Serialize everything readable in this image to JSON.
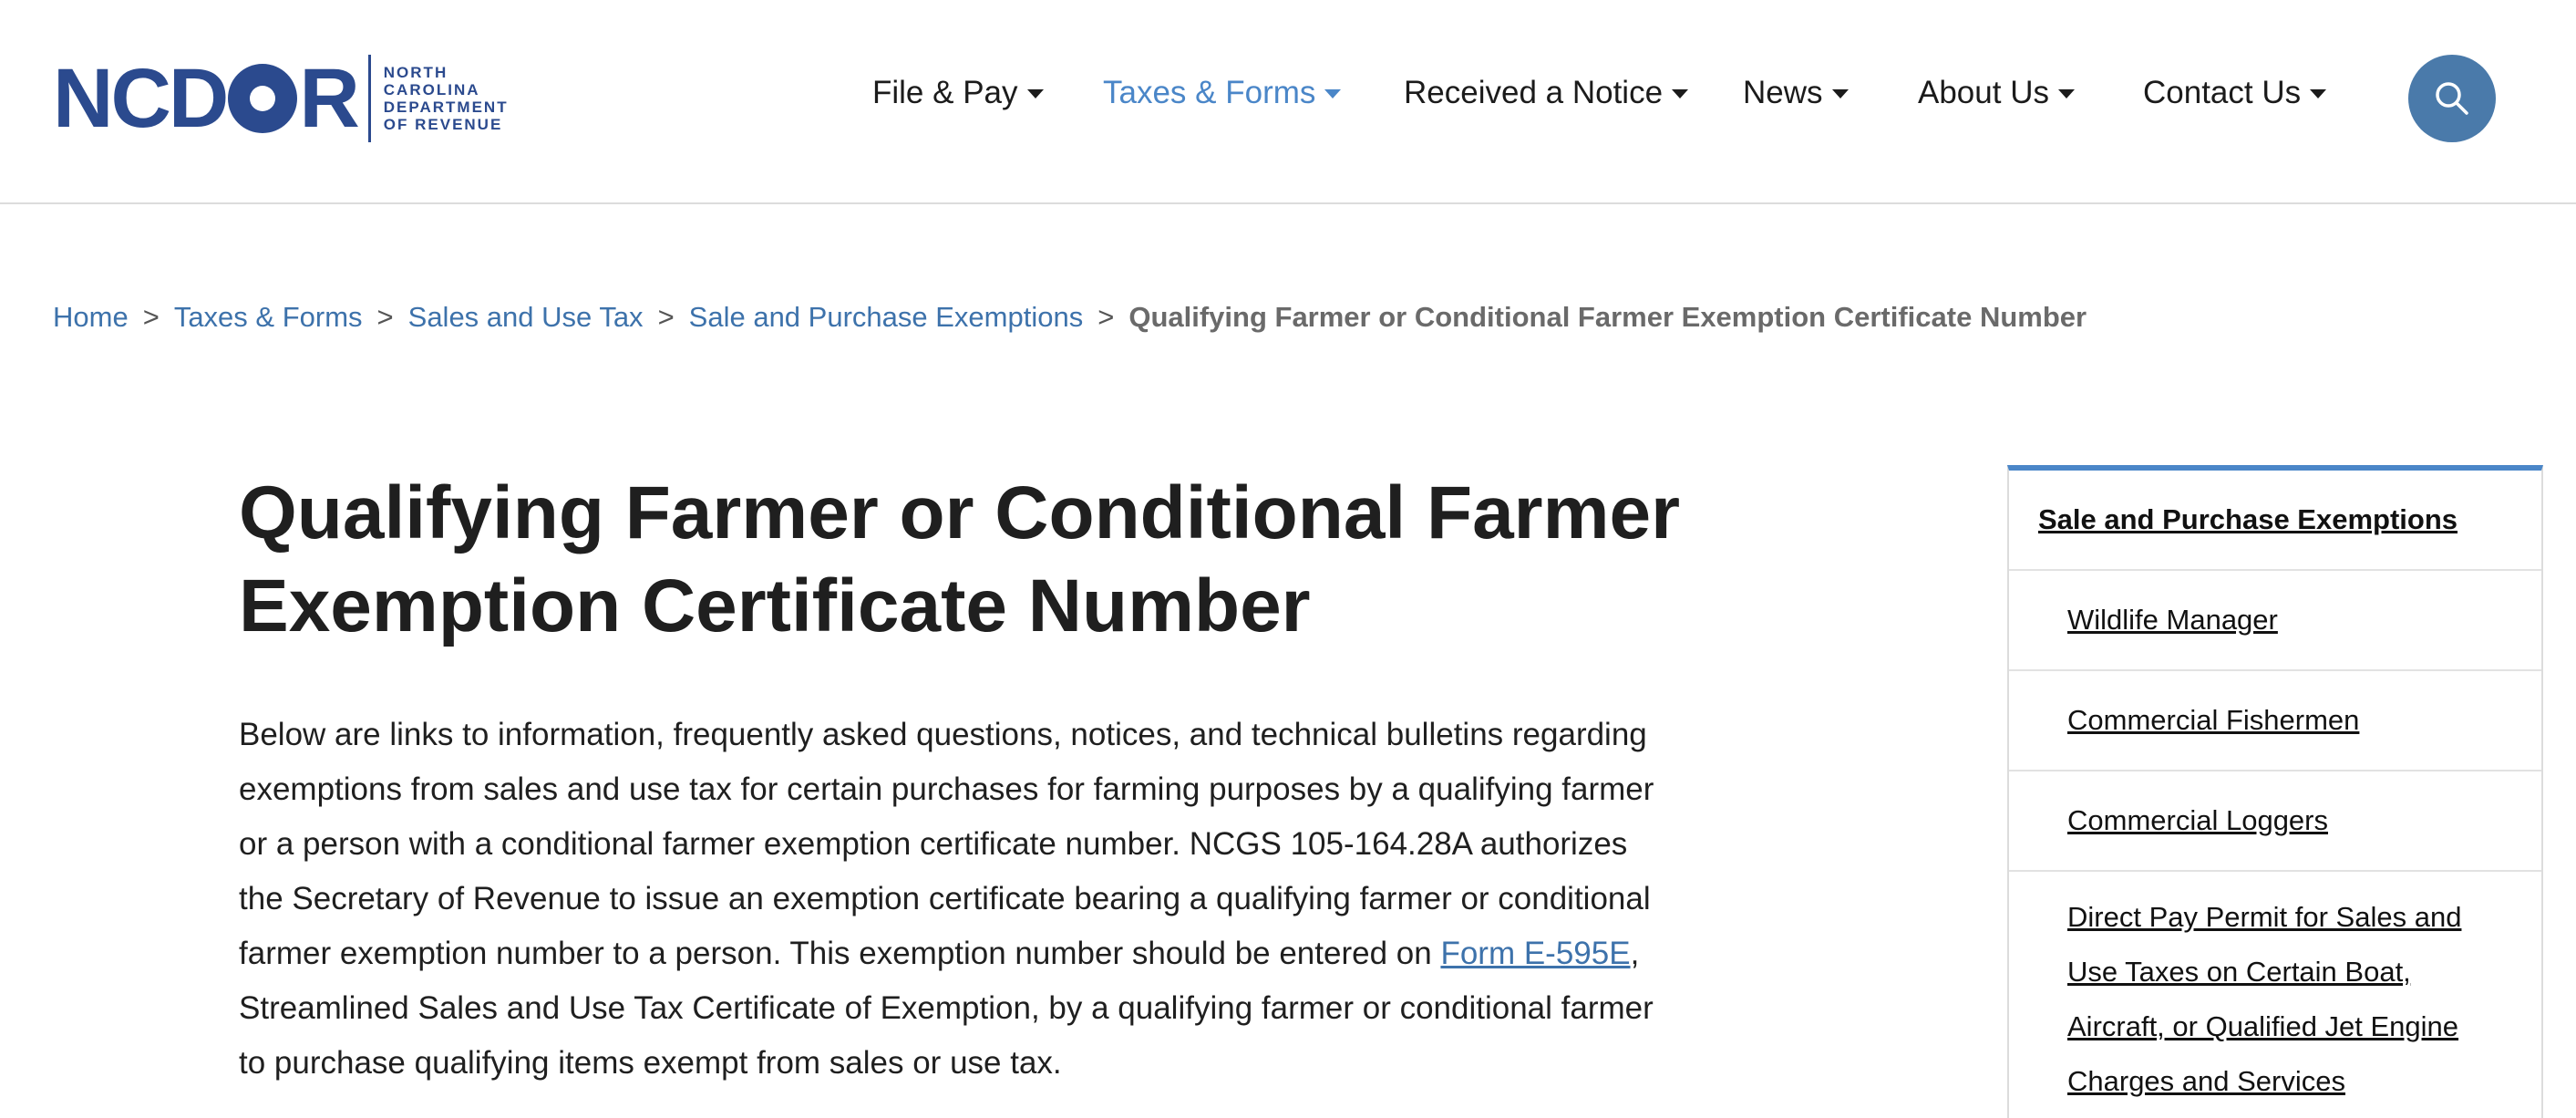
{
  "logo": {
    "word_left": "NCD",
    "word_right": "R",
    "subtitle_lines": [
      "NORTH",
      "CAROLINA",
      "DEPARTMENT",
      "OF REVENUE"
    ]
  },
  "nav": {
    "items": [
      {
        "label": "File & Pay"
      },
      {
        "label": "Taxes & Forms"
      },
      {
        "label": "Received a Notice"
      },
      {
        "label": "News"
      },
      {
        "label": "About Us"
      },
      {
        "label": "Contact Us"
      }
    ],
    "active": "Taxes & Forms",
    "search_icon": "search-icon"
  },
  "breadcrumb": {
    "links": [
      "Home",
      "Taxes & Forms",
      "Sales and Use Tax",
      "Sale and Purchase Exemptions"
    ],
    "separator": ">",
    "current": "Qualifying Farmer or Conditional Farmer Exemption Certificate Number"
  },
  "main": {
    "title": "Qualifying Farmer or Conditional Farmer Exemption Certificate Number",
    "paragraph_before_link": "Below are links to information, frequently asked questions, notices, and technical bulletins regarding exemptions from sales and use tax for certain purchases for farming purposes by a qualifying farmer or a person with a conditional farmer exemption certificate number.  NCGS 105-164.28A authorizes the Secretary of Revenue to issue an exemption certificate bearing a qualifying farmer or conditional farmer exemption number to a person.  This exemption number should be entered on ",
    "paragraph_link": "Form E-595E",
    "paragraph_after_link": ", Streamlined Sales and Use Tax Certificate of Exemption, by a qualifying farmer or conditional farmer to purchase qualifying items exempt from sales or use tax."
  },
  "sidebar": {
    "heading": "Sale and Purchase Exemptions",
    "items": [
      "Wildlife Manager",
      "Commercial Fishermen",
      "Commercial Loggers",
      "Direct Pay Permit for Sales and Use Taxes on Certain Boat, Aircraft, or Qualified Jet Engine Charges and Services"
    ]
  },
  "colors": {
    "brand": "#2b4a8e",
    "accent": "#4a86c8",
    "link": "#3d72ab",
    "search_button": "#4a7aaa"
  }
}
